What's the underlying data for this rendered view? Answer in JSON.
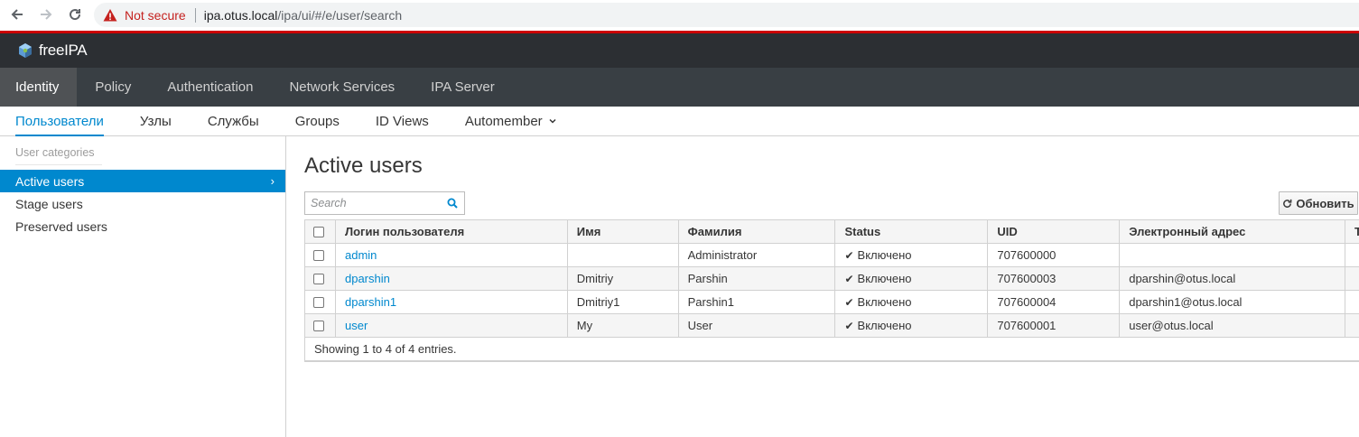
{
  "browser": {
    "not_secure_label": "Not secure",
    "url_host": "ipa.otus.local",
    "url_path": "/ipa/ui/#/e/user/search"
  },
  "brand": {
    "name": "freeIPA"
  },
  "top_nav": {
    "items": [
      {
        "label": "Identity",
        "active": true
      },
      {
        "label": "Policy"
      },
      {
        "label": "Authentication"
      },
      {
        "label": "Network Services"
      },
      {
        "label": "IPA Server"
      }
    ]
  },
  "sub_nav": {
    "items": [
      {
        "label": "Пользователи",
        "active": true
      },
      {
        "label": "Узлы"
      },
      {
        "label": "Службы"
      },
      {
        "label": "Groups"
      },
      {
        "label": "ID Views"
      },
      {
        "label": "Automember"
      }
    ]
  },
  "sidebar": {
    "heading": "User categories",
    "items": [
      {
        "label": "Active users",
        "active": true
      },
      {
        "label": "Stage users"
      },
      {
        "label": "Preserved users"
      }
    ]
  },
  "main": {
    "title": "Active users",
    "search_placeholder": "Search",
    "refresh_label": "Обновить"
  },
  "table": {
    "columns": [
      "Логин пользователя",
      "Имя",
      "Фамилия",
      "Status",
      "UID",
      "Электронный адрес",
      "T"
    ],
    "rows": [
      {
        "login": "admin",
        "first": "",
        "last": "Administrator",
        "status": "Включено",
        "uid": "707600000",
        "email": ""
      },
      {
        "login": "dparshin",
        "first": "Dmitriy",
        "last": "Parshin",
        "status": "Включено",
        "uid": "707600003",
        "email": "dparshin@otus.local"
      },
      {
        "login": "dparshin1",
        "first": "Dmitriy1",
        "last": "Parshin1",
        "status": "Включено",
        "uid": "707600004",
        "email": "dparshin1@otus.local"
      },
      {
        "login": "user",
        "first": "My",
        "last": "User",
        "status": "Включено",
        "uid": "707600001",
        "email": "user@otus.local"
      }
    ],
    "footer": "Showing 1 to 4 of 4 entries."
  },
  "colors": {
    "accent": "#0088ce",
    "brand_bg": "#2c2f33",
    "nav_bg": "#393f44",
    "warning": "#c5221f"
  }
}
